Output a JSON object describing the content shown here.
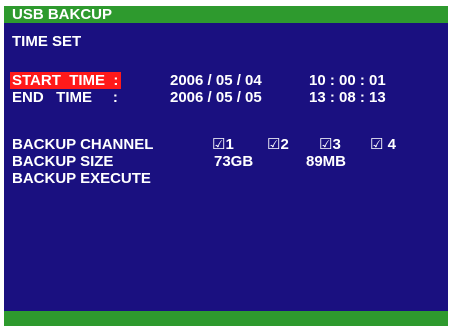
{
  "title": "USB BAKCUP",
  "section_title": "TIME SET",
  "start": {
    "label": "START  TIME  :",
    "date": "2006 / 05 / 04",
    "time": "10 : 00 : 01"
  },
  "end": {
    "label": "END   TIME     :",
    "date": "2006 / 05 / 05",
    "time": "13 : 08 : 13"
  },
  "backup_channel": {
    "label": "BACKUP CHANNEL",
    "channels": [
      {
        "box": "☑",
        "num": "1",
        "checked": true
      },
      {
        "box": "☑",
        "num": "2",
        "checked": true
      },
      {
        "box": "☑",
        "num": "3",
        "checked": true
      },
      {
        "box": "☑",
        "num": " 4",
        "checked": true
      }
    ]
  },
  "backup_size": {
    "label": "BACKUP SIZE",
    "gb": "73GB",
    "mb": "89MB"
  },
  "backup_execute": {
    "label": "BACKUP EXECUTE"
  },
  "colors": {
    "background": "#1a1080",
    "bar": "#2e9a2e",
    "highlight": "#ff1a1a",
    "text": "#ffffff"
  }
}
